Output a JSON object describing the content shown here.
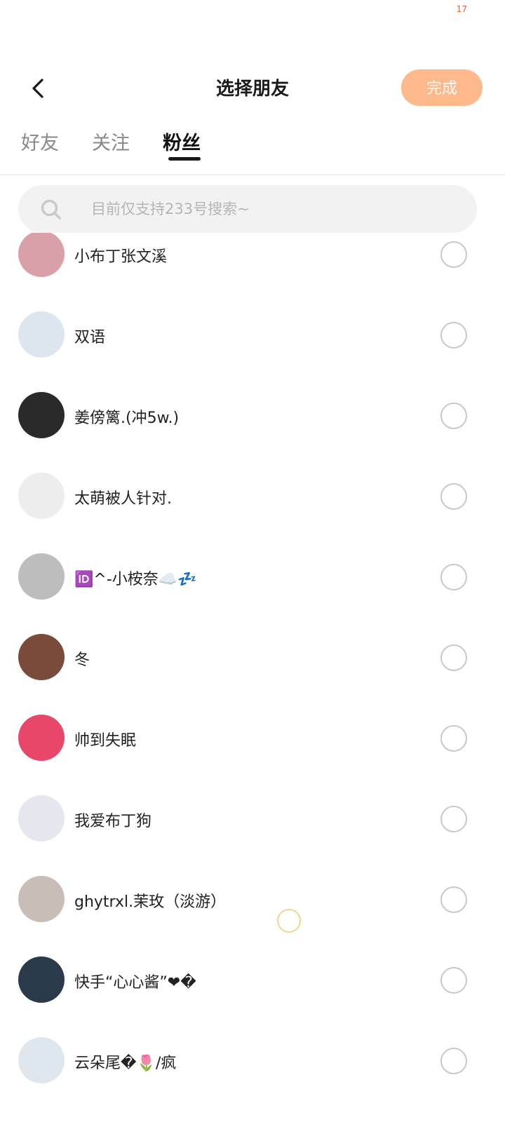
{
  "status": {
    "time": "17"
  },
  "header": {
    "title": "选择朋友",
    "done_label": "完成"
  },
  "tabs": [
    {
      "label": "好友",
      "active": false
    },
    {
      "label": "关注",
      "active": false
    },
    {
      "label": "粉丝",
      "active": true
    }
  ],
  "search": {
    "placeholder": "目前仅支持233号搜索~",
    "icon": "search-icon"
  },
  "friends": [
    {
      "name": "小布丁张文溪",
      "avatar_color": "#d9a0a8"
    },
    {
      "name": "双语",
      "avatar_color": "#dde6ee"
    },
    {
      "name": "姜傍篱.(冲5w.)",
      "avatar_color": "#2a2a2a"
    },
    {
      "name": "太萌被人针对.",
      "avatar_color": "#ededed"
    },
    {
      "name": "🆔^-小桉奈☁️💤",
      "avatar_color": "#bdbdbd"
    },
    {
      "name": "冬",
      "avatar_color": "#7a4a3a"
    },
    {
      "name": "帅到失眠",
      "avatar_color": "#e8476a"
    },
    {
      "name": "我爱布丁狗",
      "avatar_color": "#e6e6ee"
    },
    {
      "name": "ghytrxl.茉玫（淡游）",
      "avatar_color": "#c9bdb8"
    },
    {
      "name": "快手“心心酱”❤�",
      "avatar_color": "#2b3a4a"
    },
    {
      "name": "云朵尾�🌷/疯",
      "avatar_color": "#dfe7ee"
    }
  ]
}
